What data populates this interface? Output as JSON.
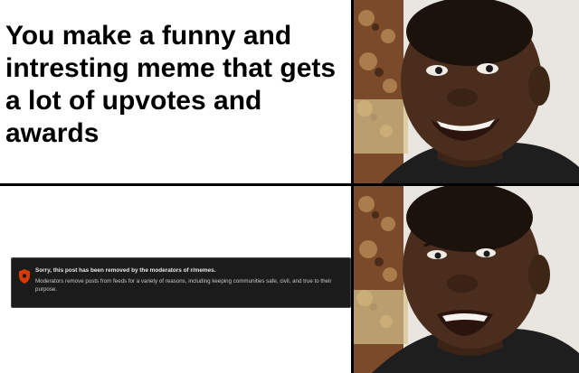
{
  "meme": {
    "top_text": "You make a funny and intresting meme that gets a lot of upvotes and awards",
    "notice": {
      "title": "Sorry, this post has been removed by the moderators of r/memes.",
      "body": "Moderators remove posts from feeds for a variety of reasons, including keeping communities safe, civil, and true to their purpose.",
      "shield_icon": "shield-icon",
      "accent_color": "#d93a00"
    }
  }
}
